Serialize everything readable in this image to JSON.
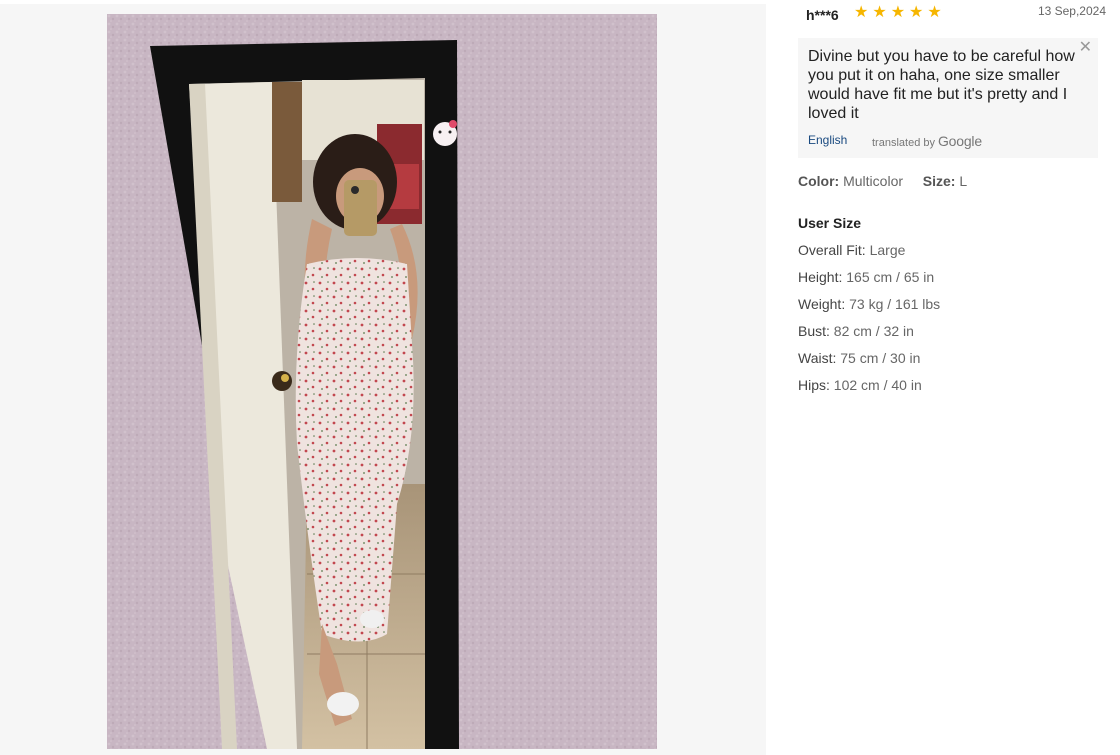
{
  "review": {
    "username": "h***6",
    "rating": 5,
    "stars": [
      "★",
      "★",
      "★",
      "★",
      "★"
    ],
    "star_color": "#f6b600",
    "date": "13 Sep,2024",
    "comment": "Divine but you have to be careful how you put it on haha, one size smaller would have fit me but it's pretty and I loved it",
    "language": "English",
    "translated_by_label": "translated by",
    "translator": "Google",
    "close_icon": "close-icon"
  },
  "attributes": {
    "color_label": "Color:",
    "color_value": "Multicolor",
    "size_label": "Size:",
    "size_value": "L"
  },
  "user_size": {
    "title": "User Size",
    "items": [
      {
        "label": "Overall Fit:",
        "value": "Large"
      },
      {
        "label": "Height:",
        "value": "165 cm / 65 in"
      },
      {
        "label": "Weight:",
        "value": "73 kg / 161 lbs"
      },
      {
        "label": "Bust:",
        "value": "82 cm / 32 in"
      },
      {
        "label": "Waist:",
        "value": "75 cm / 30 in"
      },
      {
        "label": "Hips:",
        "value": "102 cm / 40 in"
      }
    ]
  },
  "colors": {
    "panel_bg": "#f6f6f6",
    "wall": "#c9b8c4",
    "mirror_frame": "#111111",
    "link": "#1a4a80"
  }
}
